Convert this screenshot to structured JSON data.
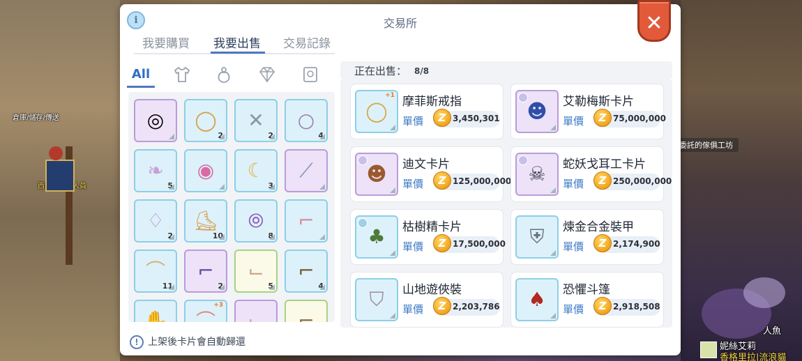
{
  "background": {
    "sign_left": "倉庫/儲存/傳送",
    "name_left": "西海拉德傳人員",
    "pill_right": "委託的傢俱工坊",
    "name_right_1": "人魚",
    "name_right_2": "妮絲艾莉",
    "name_right_3": "香格里拉|流浪貓"
  },
  "window": {
    "title": "交易所",
    "info_icon": "i",
    "close_icon": "✕"
  },
  "tabs": [
    {
      "label": "我要購買",
      "active": false
    },
    {
      "label": "我要出售",
      "active": true
    },
    {
      "label": "交易記錄",
      "active": false
    }
  ],
  "categories": {
    "all_label": "All",
    "icons": [
      "shirt-icon",
      "potion-bottle-icon",
      "gem-icon",
      "card-icon"
    ]
  },
  "inventory": [
    {
      "icon": "bracelet-icon",
      "qty": "",
      "frame": "purple"
    },
    {
      "icon": "ring-icon",
      "qty": "2",
      "frame": "blue"
    },
    {
      "icon": "crossed-chain-icon",
      "qty": "2",
      "frame": "blue"
    },
    {
      "icon": "ring-icon",
      "qty": "4",
      "frame": "blue"
    },
    {
      "icon": "feather-icon",
      "qty": "5",
      "frame": "blue"
    },
    {
      "icon": "ring-icon",
      "qty": "",
      "frame": "blue"
    },
    {
      "icon": "crescent-icon",
      "qty": "3",
      "frame": "blue"
    },
    {
      "icon": "arm-guard-icon",
      "qty": "",
      "frame": "purple"
    },
    {
      "icon": "necklace-icon",
      "qty": "2",
      "frame": "blue"
    },
    {
      "icon": "sandal-icon",
      "qty": "10",
      "frame": "blue"
    },
    {
      "icon": "bead-bracelet-icon",
      "qty": "8",
      "frame": "blue"
    },
    {
      "icon": "boot-icon",
      "qty": "",
      "frame": "blue"
    },
    {
      "icon": "shoe-icon",
      "qty": "11",
      "frame": "blue"
    },
    {
      "icon": "boot-icon",
      "qty": "2",
      "frame": "purple"
    },
    {
      "icon": "sock-icon",
      "qty": "5",
      "frame": "green"
    },
    {
      "icon": "boot-icon",
      "qty": "4",
      "frame": "blue"
    },
    {
      "icon": "glove-icon",
      "qty": "",
      "frame": "blue"
    },
    {
      "icon": "shoe-icon",
      "qty": "",
      "frame": "blue",
      "plus": "+3"
    },
    {
      "icon": "sock-icon",
      "qty": "",
      "frame": "purple"
    },
    {
      "icon": "boot-icon",
      "qty": "",
      "frame": "green"
    }
  ],
  "selling": {
    "label": "正在出售：",
    "count": "8/8",
    "price_label": "單價",
    "coin": "Z",
    "items": [
      {
        "name": "摩菲斯戒指",
        "price": "3,450,301",
        "icon": "ring-icon",
        "frame": "blue",
        "plus": "+1"
      },
      {
        "name": "艾勒梅斯卡片",
        "price": "75,000,000",
        "icon": "card-portrait-icon",
        "frame": "purple"
      },
      {
        "name": "迪文卡片",
        "price": "125,000,000",
        "icon": "card-portrait-icon",
        "frame": "purple"
      },
      {
        "name": "蛇妖戈耳工卡片",
        "price": "250,000,000",
        "icon": "card-portrait-icon",
        "frame": "purple"
      },
      {
        "name": "枯樹精卡片",
        "price": "17,500,000",
        "icon": "card-portrait-icon",
        "frame": "blue"
      },
      {
        "name": "煉金合金裝甲",
        "price": "2,174,900",
        "icon": "armor-icon",
        "frame": "blue"
      },
      {
        "name": "山地遊俠裝",
        "price": "2,203,786",
        "icon": "robe-icon",
        "frame": "blue"
      },
      {
        "name": "恐懼斗篷",
        "price": "2,918,508",
        "icon": "cloak-icon",
        "frame": "blue"
      }
    ]
  },
  "hint": {
    "icon": "!",
    "text": "上架後卡片會自動歸還"
  },
  "colors": {
    "accent": "#4d78c2",
    "close": "#e25a3a",
    "coin": "#f2a41a",
    "price_label": "#3c78c7"
  }
}
